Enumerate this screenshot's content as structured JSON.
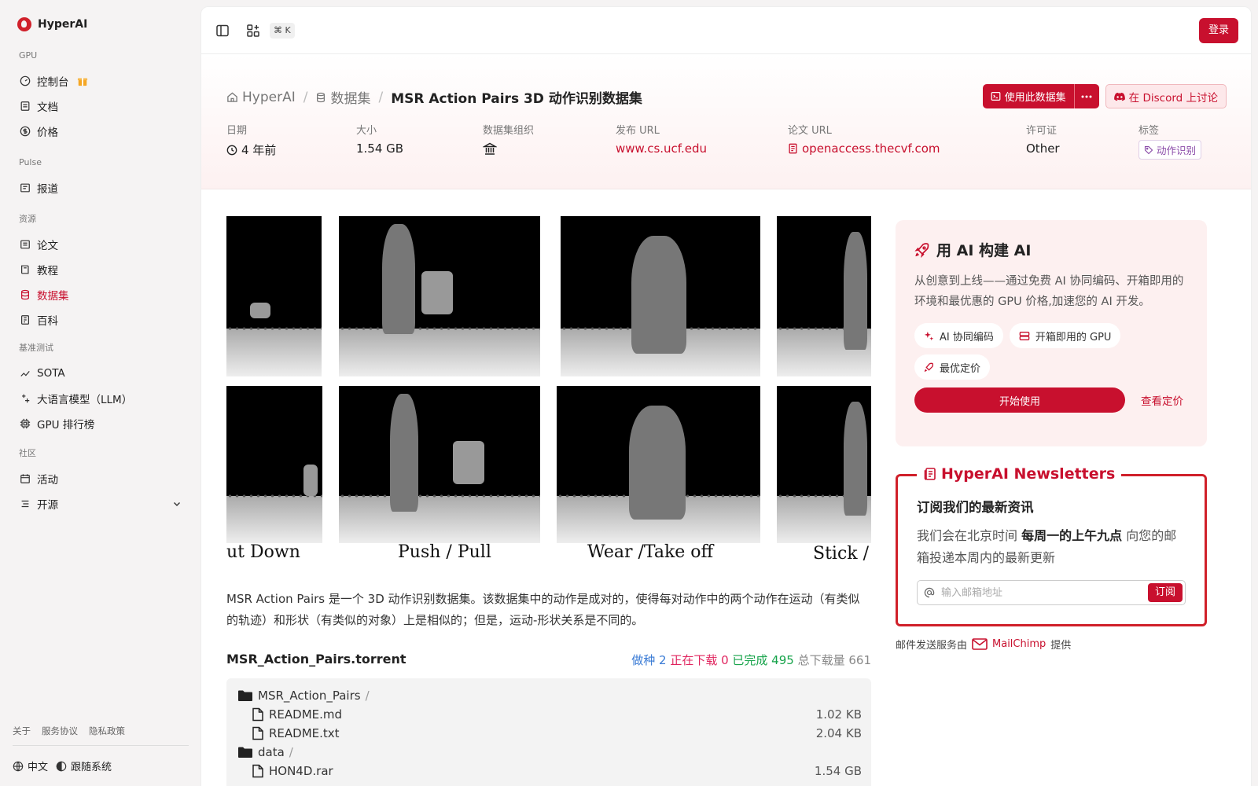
{
  "brand": {
    "name": "HyperAI"
  },
  "sidebar": {
    "groups": [
      {
        "heading": "GPU",
        "items": [
          {
            "label": "控制台",
            "icon": "dashboard-icon"
          },
          {
            "label": "文档",
            "icon": "doc-icon"
          },
          {
            "label": "价格",
            "icon": "dollar-icon"
          }
        ]
      },
      {
        "heading": "Pulse",
        "items": [
          {
            "label": "报道",
            "icon": "news-icon"
          }
        ]
      },
      {
        "heading": "资源",
        "items": [
          {
            "label": "论文",
            "icon": "paper-icon"
          },
          {
            "label": "教程",
            "icon": "book-icon"
          },
          {
            "label": "数据集",
            "icon": "database-icon",
            "active": true
          },
          {
            "label": "百科",
            "icon": "wiki-icon"
          }
        ]
      },
      {
        "heading": "基准测试",
        "items": [
          {
            "label": "SOTA",
            "icon": "trend-icon"
          },
          {
            "label": "大语言模型（LLM）",
            "icon": "sparkle-icon"
          },
          {
            "label": "GPU 排行榜",
            "icon": "chip-icon"
          }
        ]
      },
      {
        "heading": "社区",
        "items": [
          {
            "label": "活动",
            "icon": "calendar-icon"
          },
          {
            "label": "开源",
            "icon": "list-icon"
          }
        ]
      }
    ],
    "footer_links": [
      "关于",
      "服务协议",
      "隐私政策"
    ],
    "language": "中文",
    "theme": "跟随系统"
  },
  "topbar": {
    "shortcut": "⌘ K",
    "login": "登录"
  },
  "breadcrumb": {
    "home": "HyperAI",
    "section": "数据集",
    "current": "MSR Action Pairs 3D 动作识别数据集"
  },
  "actions": {
    "use_dataset": "使用此数据集",
    "discord": "在 Discord 上讨论"
  },
  "meta": {
    "date_label": "日期",
    "date_value": "4 年前",
    "size_label": "大小",
    "size_value": "1.54 GB",
    "org_label": "数据集组织",
    "publish_label": "发布 URL",
    "publish_value": "www.cs.ucf.edu",
    "paper_label": "论文 URL",
    "paper_value": "openaccess.thecvf.com",
    "license_label": "许可证",
    "license_value": "Other",
    "tags_label": "标签",
    "tag_value": "动作识别"
  },
  "preview": {
    "captions": [
      "ut Down",
      "Push / Pull",
      "Wear /Take off",
      "Stick / F"
    ]
  },
  "description": "MSR Action Pairs 是一个 3D 动作识别数据集。该数据集中的动作是成对的，使得每对动作中的两个动作在运动（有类似的轨迹）和形状（有类似的对象）上是相似的；但是，运动-形状关系是不同的。",
  "torrent": {
    "title": "MSR_Action_Pairs.torrent",
    "seeding": "做种 2",
    "downloading": "正在下载 0",
    "completed": "已完成 495",
    "total": "总下载量 661",
    "files": [
      {
        "name": "MSR_Action_Pairs",
        "type": "folder",
        "size": ""
      },
      {
        "name": "README.md",
        "type": "file",
        "size": "1.02 KB"
      },
      {
        "name": "README.txt",
        "type": "file",
        "size": "2.04 KB"
      },
      {
        "name": "data",
        "type": "folder",
        "size": ""
      },
      {
        "name": "HON4D.rar",
        "type": "file",
        "size": "1.54 GB"
      }
    ]
  },
  "ai_card": {
    "title": "用 AI 构建 AI",
    "desc": "从创意到上线——通过免费 AI 协同编码、开箱即用的环境和最优惠的 GPU 价格,加速您的 AI 开发。",
    "chips": [
      "AI 协同编码",
      "开箱即用的 GPU",
      "最优定价"
    ],
    "start": "开始使用",
    "pricing": "查看定价"
  },
  "newsletter": {
    "legend": "HyperAI Newsletters",
    "heading": "订阅我们的最新资讯",
    "text_before": "我们会在北京时间 ",
    "text_bold": "每周一的上午九点",
    "text_after": " 向您的邮箱投递本周内的最新更新",
    "placeholder": "输入邮箱地址",
    "subscribe": "订阅",
    "powered_before": "邮件发送服务由",
    "powered_brand": "MailChimp",
    "powered_after": "提供"
  },
  "colors": {
    "accent": "#c8102e"
  }
}
